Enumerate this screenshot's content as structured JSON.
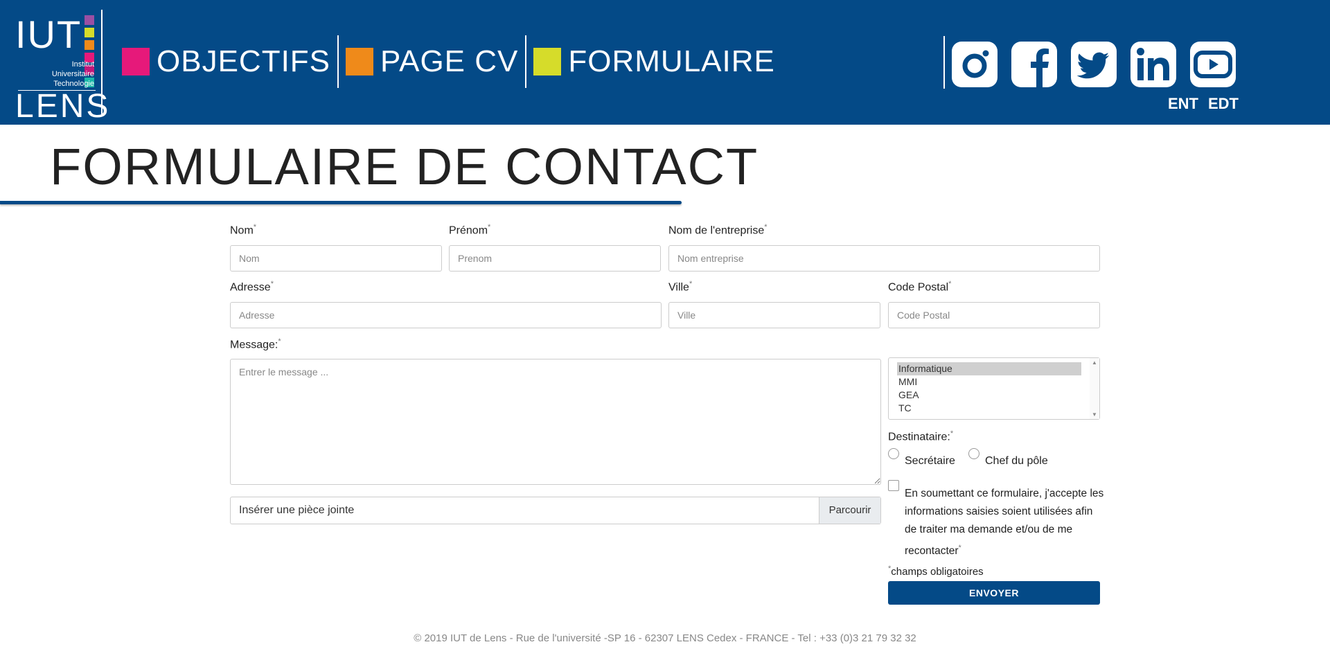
{
  "header": {
    "logo": {
      "line1": "IUT",
      "sub1": "Institut",
      "sub2": "Universitaire",
      "sub3": "Technologie",
      "line2": "LENS"
    },
    "nav": [
      {
        "label": "OBJECTIFS",
        "color": "#e6197a"
      },
      {
        "label": "PAGE CV",
        "color": "#ef8a1a"
      },
      {
        "label": "FORMULAIRE",
        "color": "#d6dc2a"
      }
    ],
    "social": [
      "instagram-icon",
      "facebook-icon",
      "twitter-icon",
      "linkedin-icon",
      "youtube-icon"
    ],
    "links": {
      "ent": "ENT",
      "edt": "EDT"
    },
    "bg_color": "#044a87"
  },
  "page": {
    "title": "FORMULAIRE DE CONTACT"
  },
  "form": {
    "nom": {
      "label": "Nom",
      "placeholder": "Nom"
    },
    "prenom": {
      "label": "Prénom",
      "placeholder": "Prenom"
    },
    "entreprise": {
      "label": "Nom de l'entreprise",
      "placeholder": "Nom entreprise"
    },
    "adresse": {
      "label": "Adresse",
      "placeholder": "Adresse"
    },
    "ville": {
      "label": "Ville",
      "placeholder": "Ville"
    },
    "code_postal": {
      "label": "Code Postal",
      "placeholder": "Code Postal"
    },
    "message": {
      "label": "Message:",
      "placeholder": "Entrer le message ..."
    },
    "attachment": {
      "text": "Insérer une pièce jointe",
      "button": "Parcourir"
    },
    "departments": {
      "options": [
        "Informatique",
        "MMI",
        "GEA",
        "TC"
      ],
      "selected": "Informatique"
    },
    "destinataire": {
      "label": "Destinataire:",
      "options": [
        "Secrétaire",
        "Chef du pôle"
      ]
    },
    "consent": "En soumettant ce formulaire, j'accepte les informations saisies soient utilisées afin de traiter ma demande et/ou de me recontacter",
    "required_note": "champs obligatoires",
    "required_mark": "*",
    "submit": "ENVOYER"
  },
  "footer": {
    "text": "© 2019 IUT de Lens - Rue de l'université -SP 16 - 62307 LENS Cedex - FRANCE - Tel : +33 (0)3 21 79 32 32"
  }
}
